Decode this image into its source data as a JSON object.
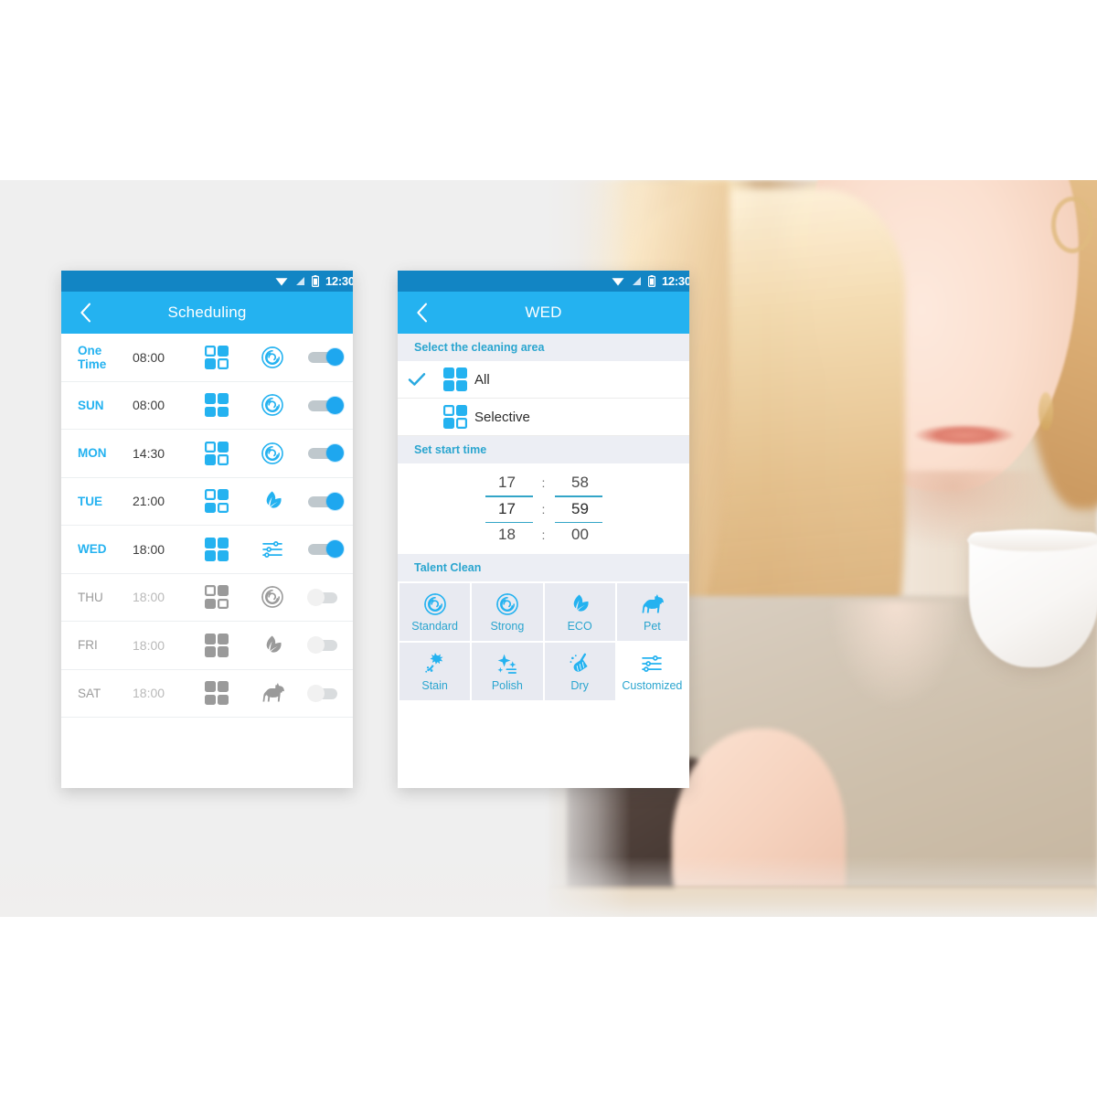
{
  "colors": {
    "accent": "#24b2f0",
    "status_bar": "#1285c4",
    "section_header_text": "#2aa5cf",
    "section_header_bg": "#eceef4",
    "tile_bg": "#e8eaf1",
    "page_bg": "#efefef",
    "disabled": "#9a9a9a"
  },
  "left_phone": {
    "status_bar": {
      "time": "12:30",
      "icons": [
        "wifi-icon",
        "signal-icon",
        "battery-icon"
      ]
    },
    "app_bar": {
      "back": "back-arrow-icon",
      "title": "Scheduling"
    },
    "rows": [
      {
        "day": "One Time",
        "time": "08:00",
        "area": "selective",
        "mode": "standard",
        "enabled": true
      },
      {
        "day": "SUN",
        "time": "08:00",
        "area": "all",
        "mode": "standard",
        "enabled": true
      },
      {
        "day": "MON",
        "time": "14:30",
        "area": "selective",
        "mode": "standard",
        "enabled": true
      },
      {
        "day": "TUE",
        "time": "21:00",
        "area": "selective",
        "mode": "eco",
        "enabled": true
      },
      {
        "day": "WED",
        "time": "18:00",
        "area": "all",
        "mode": "customized",
        "enabled": true
      },
      {
        "day": "THU",
        "time": "18:00",
        "area": "selective",
        "mode": "standard",
        "enabled": false
      },
      {
        "day": "FRI",
        "time": "18:00",
        "area": "all",
        "mode": "eco",
        "enabled": false
      },
      {
        "day": "SAT",
        "time": "18:00",
        "area": "all",
        "mode": "pet",
        "enabled": false
      }
    ]
  },
  "right_phone": {
    "status_bar": {
      "time": "12:30",
      "icons": [
        "wifi-icon",
        "signal-icon",
        "battery-icon"
      ]
    },
    "app_bar": {
      "back": "back-arrow-icon",
      "title": "WED"
    },
    "cleaning_area": {
      "header": "Select the cleaning area",
      "options": [
        {
          "label": "All",
          "icon": "area-all-icon",
          "checked": true
        },
        {
          "label": "Selective",
          "icon": "area-selective-icon",
          "checked": false
        }
      ]
    },
    "start_time": {
      "header": "Set start time",
      "separator": ":",
      "rows": [
        {
          "hour": "17",
          "minute": "58",
          "selected": false
        },
        {
          "hour": "17",
          "minute": "59",
          "selected": true
        },
        {
          "hour": "18",
          "minute": "00",
          "selected": false
        }
      ]
    },
    "talent_clean": {
      "header": "Talent Clean",
      "tiles": [
        {
          "label": "Standard",
          "icon": "spiral-icon",
          "selected": false
        },
        {
          "label": "Strong",
          "icon": "spiral-icon",
          "selected": false
        },
        {
          "label": "ECO",
          "icon": "leaf-icon",
          "selected": false
        },
        {
          "label": "Pet",
          "icon": "dog-icon",
          "selected": false
        },
        {
          "label": "Stain",
          "icon": "splash-icon",
          "selected": false
        },
        {
          "label": "Polish",
          "icon": "sparkle-icon",
          "selected": false
        },
        {
          "label": "Dry",
          "icon": "broom-icon",
          "selected": false
        },
        {
          "label": "Customized",
          "icon": "sliders-icon",
          "selected": true
        }
      ]
    }
  }
}
